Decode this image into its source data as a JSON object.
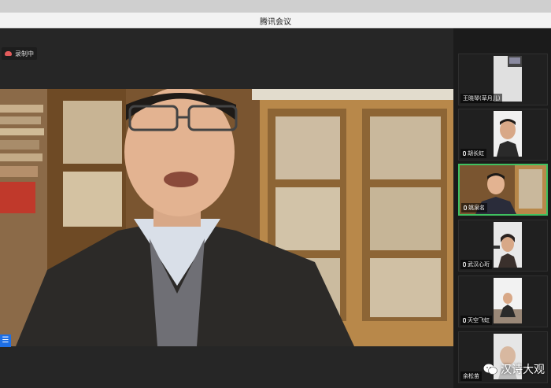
{
  "window": {
    "title": "腾讯会议"
  },
  "recording": {
    "label": "录制中",
    "icon": "cloud-record-icon"
  },
  "participants": [
    {
      "name": "王晓琴(草月儿)",
      "mic": false
    },
    {
      "name": "胡长虹",
      "mic": true
    },
    {
      "name": "姚泉名",
      "mic": true,
      "active": true
    },
    {
      "name": "武汉心珩",
      "mic": true
    },
    {
      "name": "天空飞虹",
      "mic": true
    },
    {
      "name": "余松苗",
      "mic": false
    }
  ],
  "watermark": {
    "text": "汉诗大观",
    "icon": "wechat-icon"
  },
  "menu_button": {
    "glyph": "☰"
  },
  "colors": {
    "active_border": "#3fc060",
    "menu_blue": "#1d6fe6",
    "record_red": "#e35b5b"
  }
}
